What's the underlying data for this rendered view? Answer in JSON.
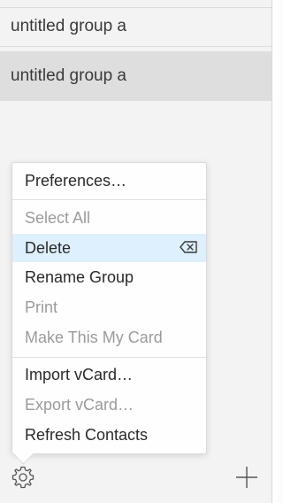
{
  "groups": [
    {
      "label": "untitled group a",
      "selected": false
    },
    {
      "label": "untitled group a",
      "selected": true
    }
  ],
  "menu": {
    "items": [
      {
        "label": "Preferences…",
        "enabled": true
      },
      {
        "label": "Select All",
        "enabled": false
      },
      {
        "label": "Delete",
        "enabled": true,
        "highlighted": true
      },
      {
        "label": "Rename Group",
        "enabled": true
      },
      {
        "label": "Print",
        "enabled": false
      },
      {
        "label": "Make This My Card",
        "enabled": false
      },
      {
        "label": "Import vCard…",
        "enabled": true
      },
      {
        "label": "Export vCard…",
        "enabled": false
      },
      {
        "label": "Refresh Contacts",
        "enabled": true
      }
    ]
  },
  "toolbar": {
    "left_icon": "gear-icon",
    "right_icon": "plus-icon"
  },
  "colors": {
    "highlight": "#def0fd",
    "selected_row": "#dedede",
    "disabled_text": "#9b9b9b"
  }
}
